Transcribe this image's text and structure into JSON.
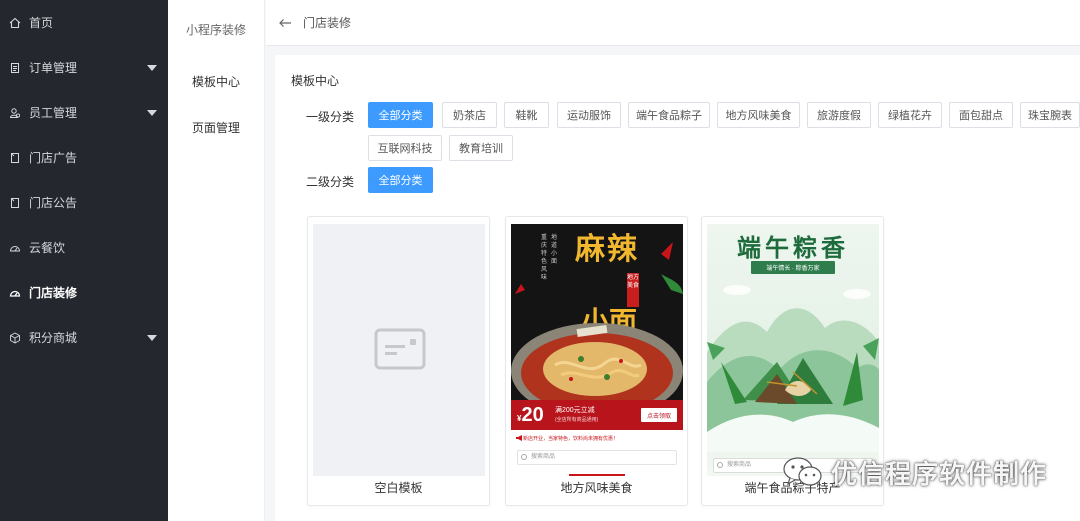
{
  "sidebar": {
    "items": [
      {
        "label": "首页",
        "icon": "home-icon",
        "has_caret": false,
        "active": false
      },
      {
        "label": "订单管理",
        "icon": "document-icon",
        "has_caret": true,
        "active": false
      },
      {
        "label": "员工管理",
        "icon": "users-icon",
        "has_caret": true,
        "active": false
      },
      {
        "label": "门店广告",
        "icon": "ad-icon",
        "has_caret": false,
        "active": false
      },
      {
        "label": "门店公告",
        "icon": "notice-icon",
        "has_caret": false,
        "active": false
      },
      {
        "label": "云餐饮",
        "icon": "dashboard-icon",
        "has_caret": false,
        "active": false
      },
      {
        "label": "门店装修",
        "icon": "dashboard-icon",
        "has_caret": false,
        "active": true
      },
      {
        "label": "积分商城",
        "icon": "cube-icon",
        "has_caret": true,
        "active": false
      }
    ]
  },
  "subnav": {
    "title": "小程序装修",
    "items": [
      "模板中心",
      "页面管理"
    ]
  },
  "header": {
    "title": "门店装修"
  },
  "main": {
    "section_title": "模板中心",
    "level1_label": "一级分类",
    "level2_label": "二级分类",
    "level1_tags": [
      "全部分类",
      "奶茶店",
      "鞋靴",
      "运动服饰",
      "端午食品粽子",
      "地方风味美食",
      "旅游度假",
      "绿植花卉",
      "面包甜点",
      "珠宝腕表",
      "互联网科技",
      "教育培训"
    ],
    "level1_selected": "全部分类",
    "level2_tags": [
      "全部分类"
    ],
    "level2_selected": "全部分类"
  },
  "templates": [
    {
      "caption": "空白模板"
    },
    {
      "caption": "地方风味美食",
      "poster": {
        "title_1": "麻辣",
        "title_2": "小面",
        "seal": "地方美食",
        "side_text_left": "重庆特色风味",
        "side_text_right": "地道小面",
        "price_symbol": "¥",
        "price": "20",
        "promo_main": "满200元立减",
        "promo_sub": "(全店所有商品通用)",
        "promo_button": "点击领取",
        "notice": "新店开业，当家特色，饮料尚未拥有优惠！",
        "search_placeholder": "搜索商品"
      }
    },
    {
      "caption": "端午食品粽子特产",
      "poster": {
        "title": "端午粽香",
        "ribbon": "端午情长 · 粽香万家",
        "search_placeholder": "搜索商品"
      }
    }
  ],
  "watermark": {
    "text": "优信程序软件制作",
    "icon": "wechat-icon"
  },
  "colors": {
    "sidebar_bg": "#24272e",
    "primary": "#3d9bff",
    "promo_red": "#b8141b",
    "zongzi_green": "#1e6b3c"
  }
}
